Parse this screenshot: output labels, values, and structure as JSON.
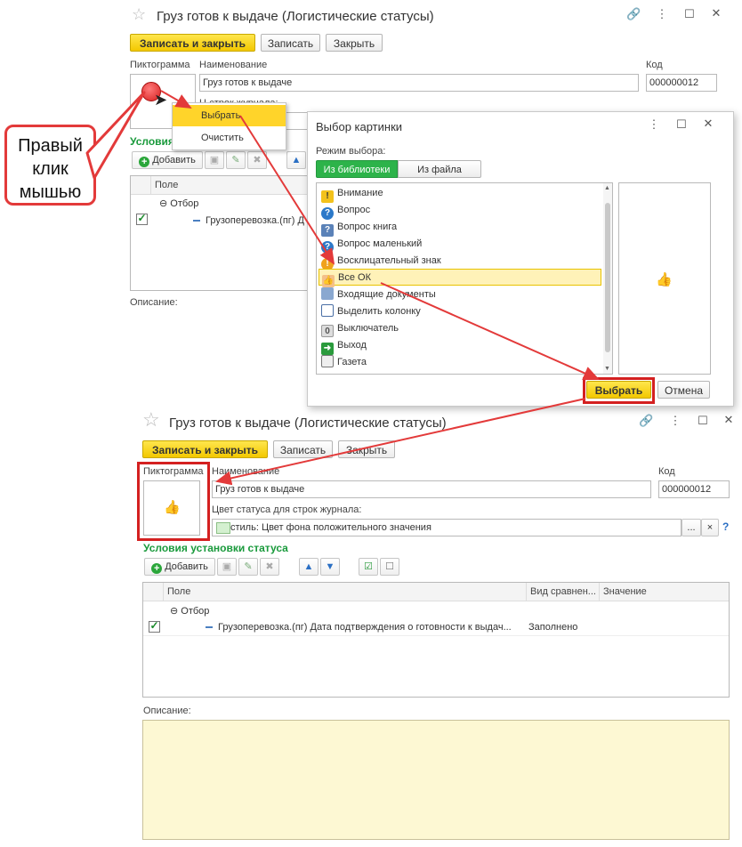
{
  "top_window": {
    "title": "Груз готов к выдаче (Логистические статусы)",
    "btn_save_close": "Записать и закрыть",
    "btn_save": "Записать",
    "btn_close": "Закрыть",
    "label_icon": "Пиктограмма",
    "label_name": "Наименование",
    "label_code": "Код",
    "name_value": "Груз готов к выдаче",
    "code_value": "000000012",
    "color_label_partial": "Ц        строк журнала:",
    "color_value_partial": "  ...  Цвет фона по...",
    "conditions_partial": "Условия",
    "add_label": "Добавить",
    "col_field": "Поле",
    "row_filter": "Отбор",
    "row_item": "Грузоперевозка.(пг) Д",
    "description_partial": "Описание:"
  },
  "context_menu": {
    "items": [
      "Выбрать",
      "Очистить"
    ]
  },
  "callout": {
    "text": [
      "Правый",
      "клик",
      "мышью"
    ]
  },
  "picker": {
    "title": "Выбор картинки",
    "mode_label": "Режим выбора:",
    "tab_library": "Из библиотеки",
    "tab_file": "Из файла",
    "items": [
      {
        "label": "Внимание",
        "icon": "warning-icon"
      },
      {
        "label": "Вопрос",
        "icon": "question-icon"
      },
      {
        "label": "Вопрос книга",
        "icon": "question-book-icon"
      },
      {
        "label": "Вопрос маленький",
        "icon": "question-small-icon"
      },
      {
        "label": "Восклицательный знак",
        "icon": "exclamation-icon"
      },
      {
        "label": "Все ОК",
        "icon": "thumbs-up-icon"
      },
      {
        "label": "Входящие документы",
        "icon": "incoming-documents-icon"
      },
      {
        "label": "Выделить колонку",
        "icon": "select-column-icon"
      },
      {
        "label": "Выключатель",
        "icon": "switch-icon"
      },
      {
        "label": "Выход",
        "icon": "exit-icon"
      },
      {
        "label": "Газета",
        "icon": "newspaper-icon"
      }
    ],
    "selected_index": 5,
    "btn_select": "Выбрать",
    "btn_cancel": "Отмена"
  },
  "bottom_window": {
    "title": "Груз готов к выдаче (Логистические статусы)",
    "btn_save_close": "Записать и закрыть",
    "btn_save": "Записать",
    "btn_close": "Закрыть",
    "label_icon": "Пиктограмма",
    "label_name": "Наименование",
    "label_code": "Код",
    "name_value": "Груз готов к выдаче",
    "code_value": "000000012",
    "color_label": "Цвет статуса для строк журнала:",
    "color_value": "стиль: Цвет фона положительного значения",
    "conditions_title": "Условия установки статуса",
    "add_label": "Добавить",
    "col_field": "Поле",
    "col_compare": "Вид сравнен...",
    "col_value": "Значение",
    "row_filter": "Отбор",
    "row_item": "Грузоперевозка.(пг) Дата подтверждения о готовности к выдач...",
    "row_compare": "Заполнено",
    "description_label": "Описание:",
    "help": "?",
    "ellipsis": "...",
    "clear": "×"
  },
  "colors": {
    "accent_red": "#e33a3a",
    "yellow_button": "#ffd42a",
    "green_heading": "#1a9a3c",
    "description_bg": "#fdf8d3"
  }
}
